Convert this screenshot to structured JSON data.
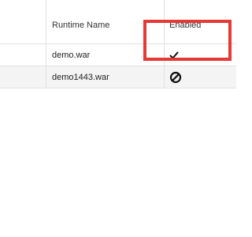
{
  "table": {
    "columns": [
      {
        "label": ""
      },
      {
        "label": "Runtime Name"
      },
      {
        "label": "Enabled"
      }
    ],
    "rows": [
      {
        "runtime_name": "demo.war",
        "enabled": true,
        "enabled_icon": "check-icon"
      },
      {
        "runtime_name": "demo1443.war",
        "enabled": false,
        "enabled_icon": "disabled-icon"
      }
    ]
  },
  "annotation": {
    "highlight_color": "#e53935",
    "highlight_target": "Enabled"
  }
}
